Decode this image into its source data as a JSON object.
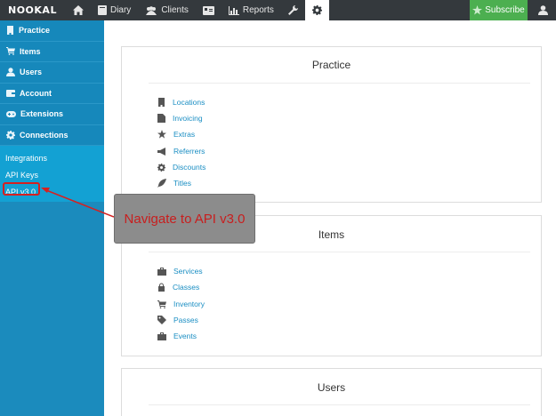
{
  "topnav": {
    "logo": "NOOKAL",
    "items": [
      {
        "label": "",
        "icon": "home-icon"
      },
      {
        "label": "Diary",
        "icon": "book-icon"
      },
      {
        "label": "Clients",
        "icon": "users-icon"
      },
      {
        "label": "",
        "icon": "id-card-icon"
      },
      {
        "label": "Reports",
        "icon": "bar-chart-icon"
      },
      {
        "label": "",
        "icon": "wrench-icon"
      },
      {
        "label": "",
        "icon": "gear-icon"
      }
    ],
    "subscribe_label": "Subscribe"
  },
  "sidebar": {
    "items": [
      {
        "label": "Practice",
        "icon": "building-icon"
      },
      {
        "label": "Items",
        "icon": "cart-icon"
      },
      {
        "label": "Users",
        "icon": "user-icon"
      },
      {
        "label": "Account",
        "icon": "wallet-icon"
      },
      {
        "label": "Extensions",
        "icon": "gamepad-icon"
      },
      {
        "label": "Connections",
        "icon": "gear-icon"
      }
    ],
    "sub_items": [
      {
        "label": "Integrations"
      },
      {
        "label": "API Keys"
      },
      {
        "label": "API v3.0"
      }
    ]
  },
  "cards": {
    "practice": {
      "title": "Practice",
      "links": [
        {
          "label": "Locations",
          "icon": "building-icon"
        },
        {
          "label": "Invoicing",
          "icon": "invoice-icon"
        },
        {
          "label": "Extras",
          "icon": "star-icon"
        },
        {
          "label": "Referrers",
          "icon": "bullhorn-icon"
        },
        {
          "label": "Discounts",
          "icon": "cog-icon"
        },
        {
          "label": "Titles",
          "icon": "feather-icon"
        }
      ]
    },
    "items": {
      "title": "Items",
      "links": [
        {
          "label": "Services",
          "icon": "briefcase-icon"
        },
        {
          "label": "Classes",
          "icon": "lock-icon"
        },
        {
          "label": "Inventory",
          "icon": "cart-icon"
        },
        {
          "label": "Passes",
          "icon": "tag-icon"
        },
        {
          "label": "Events",
          "icon": "briefcase-icon"
        }
      ]
    },
    "users": {
      "title": "Users"
    }
  },
  "callout": {
    "text": "Navigate to API v3.0"
  },
  "colors": {
    "topnav_bg": "#34393d",
    "sidebar_bg": "#1b8bbd",
    "link": "#1a8ec3",
    "subscribe": "#4caf50",
    "annotation_red": "#d62020"
  }
}
